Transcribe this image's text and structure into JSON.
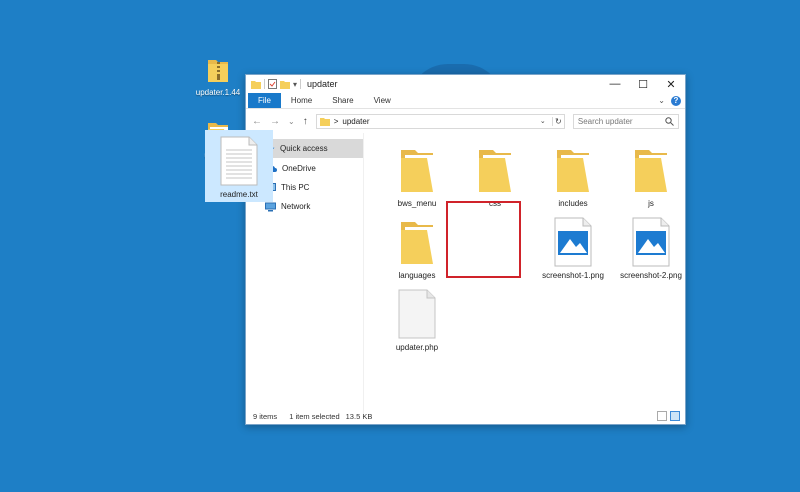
{
  "desktop": {
    "icons": [
      {
        "label": "updater.1.44",
        "type": "zip-folder"
      },
      {
        "label": "updater",
        "type": "folder"
      }
    ]
  },
  "window": {
    "title": "updater",
    "ribbon_tabs": [
      "File",
      "Home",
      "Share",
      "View"
    ],
    "address": {
      "path_sep": ">",
      "path": "updater"
    },
    "search": {
      "placeholder": "Search updater"
    },
    "nav": [
      {
        "label": "Quick access",
        "icon": "star-icon",
        "active": true
      },
      {
        "label": "OneDrive",
        "icon": "cloud-icon",
        "active": false
      },
      {
        "label": "This PC",
        "icon": "monitor-icon",
        "active": false
      },
      {
        "label": "Network",
        "icon": "network-icon",
        "active": false
      }
    ],
    "items": [
      {
        "name": "bws_menu",
        "type": "folder"
      },
      {
        "name": "css",
        "type": "folder"
      },
      {
        "name": "includes",
        "type": "folder"
      },
      {
        "name": "js",
        "type": "folder"
      },
      {
        "name": "languages",
        "type": "folder"
      },
      {
        "name": "readme.txt",
        "type": "text",
        "selected": true
      },
      {
        "name": "screenshot-1.png",
        "type": "image"
      },
      {
        "name": "screenshot-2.png",
        "type": "image"
      },
      {
        "name": "updater.php",
        "type": "file"
      }
    ],
    "status": {
      "count": "9 items",
      "selected": "1 item selected",
      "size": "13.5 KB"
    }
  },
  "colors": {
    "desktop": "#1e7fc6",
    "accent": "#1979ca",
    "folder": "#f5cf5b",
    "selection": "#cce8ff",
    "highlight": "#d0232a"
  }
}
